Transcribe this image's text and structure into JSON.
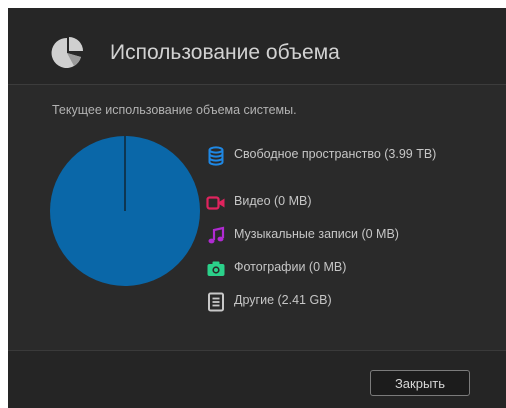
{
  "dialog": {
    "title": "Использование объема",
    "title_icon": "pie-chart-icon",
    "subtitle": "Текущее использование объема системы.",
    "close_label": "Закрыть"
  },
  "colors": {
    "pie": "#0a67a8",
    "free_space": "#1e88e5",
    "video": "#e0245e",
    "music": "#b02bd1",
    "photos": "#2bd18a",
    "other": "#c8c8c8"
  },
  "chart_data": {
    "type": "pie",
    "labels": [
      "Свободное пространство (3.99 TB)",
      "Видео (0 MB)",
      "Музыкальные записи (0 MB)",
      "Фотографии (0 MB)",
      "Другие (2.41 GB)"
    ],
    "values_bytes": [
      3990000000000.0,
      0,
      0,
      0,
      2410000000.0
    ],
    "legend_placement": "right"
  },
  "legend": [
    {
      "label": "Свободное пространство (3.99 TB)",
      "icon": "database-icon"
    },
    {
      "label": "Видео (0 MB)",
      "icon": "video-camera-icon"
    },
    {
      "label": "Музыкальные записи (0 MB)",
      "icon": "music-note-icon"
    },
    {
      "label": "Фотографии (0 MB)",
      "icon": "camera-icon"
    },
    {
      "label": "Другие (2.41 GB)",
      "icon": "document-icon"
    }
  ]
}
